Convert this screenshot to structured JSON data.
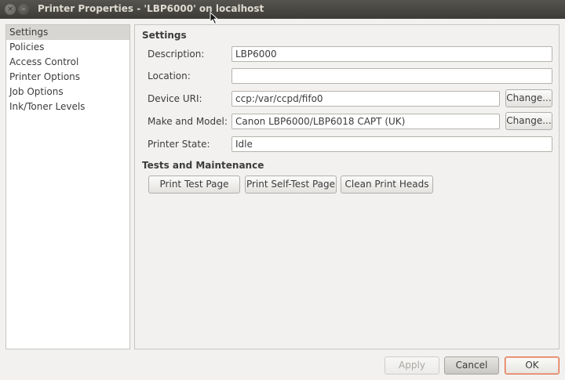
{
  "window": {
    "title": "Printer Properties - 'LBP6000' on localhost",
    "close_glyph": "×",
    "minimize_glyph": "–"
  },
  "sidebar": {
    "items": [
      {
        "label": "Settings"
      },
      {
        "label": "Policies"
      },
      {
        "label": "Access Control"
      },
      {
        "label": "Printer Options"
      },
      {
        "label": "Job Options"
      },
      {
        "label": "Ink/Toner Levels"
      }
    ],
    "selected": "Settings"
  },
  "settings": {
    "heading": "Settings",
    "description_label": "Description:",
    "description_value": "LBP6000",
    "location_label": "Location:",
    "location_value": "",
    "device_uri_label": "Device URI:",
    "device_uri_value": "ccp:/var/ccpd/fifo0",
    "device_uri_change": "Change...",
    "make_model_label": "Make and Model:",
    "make_model_value": "Canon LBP6000/LBP6018 CAPT (UK)",
    "make_model_change": "Change...",
    "state_label": "Printer State:",
    "state_value": "Idle"
  },
  "tests": {
    "heading": "Tests and Maintenance",
    "print_test_page": "Print Test Page",
    "print_self_test_page": "Print Self-Test Page",
    "clean_print_heads": "Clean Print Heads"
  },
  "footer": {
    "apply": "Apply",
    "cancel": "Cancel",
    "ok": "OK"
  }
}
